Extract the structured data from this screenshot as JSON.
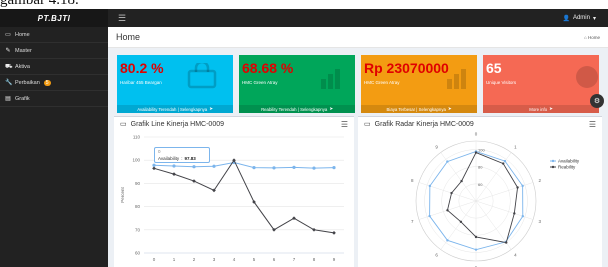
{
  "caption": "gambar 4.18.",
  "brand": "PT.BJTI",
  "admin": "Admin",
  "sidebar": [
    {
      "label": "Home",
      "icon": "monitor-icon"
    },
    {
      "label": "Master",
      "icon": "edit-icon"
    },
    {
      "label": "Aktiva",
      "icon": "truck-icon"
    },
    {
      "label": "Perbaikan",
      "icon": "wrench-icon",
      "badge": "5"
    },
    {
      "label": "Grafik",
      "icon": "bar-chart-icon"
    }
  ],
  "page_title": "Home",
  "breadcrumb": "Home",
  "tiles": [
    {
      "big": "80.2 %",
      "sub": "Haribar 455 Beargan",
      "foot": "Availability Terendah | Selengkapnya",
      "color": "#00c0ef",
      "big_color": "#e00000"
    },
    {
      "big": "68.68 %",
      "sub": "HMC Green Atray",
      "foot": "Reability Terendah | Selengkapnya",
      "color": "#00a65a",
      "big_color": "#e00000"
    },
    {
      "big": "Rp 23070000",
      "sub": "HMC Green Atray",
      "foot": "Biaya Terbesar | Selengkapnya",
      "color": "#f39c12",
      "big_color": "#e00000"
    },
    {
      "big": "65",
      "sub": "Unique Visitors",
      "foot": "More info",
      "color": "#f56954",
      "big_color": "#ffffff"
    }
  ],
  "line_panel": {
    "title": "Grafik Line Kinerja HMC-0009"
  },
  "radar_panel": {
    "title": "Grafik Radar Kinerja HMC-0009"
  },
  "tooltip": {
    "x": "0",
    "series": "Availability",
    "value": "97.83"
  },
  "chart_data": [
    {
      "type": "line",
      "title": "",
      "x": [
        0,
        1,
        2,
        3,
        4,
        5,
        6,
        7,
        8,
        9
      ],
      "ylabel": "Percent",
      "ylim": [
        60,
        110
      ],
      "yticks": [
        60,
        70,
        80,
        90,
        100,
        110
      ],
      "grid": true,
      "series": [
        {
          "name": "Availability",
          "color": "#7cb5ec",
          "values": [
            97.83,
            97.5,
            97.2,
            97.4,
            99.0,
            96.8,
            96.7,
            96.9,
            96.6,
            96.8
          ]
        },
        {
          "name": "Reability",
          "color": "#434348",
          "values": [
            96.5,
            94,
            91,
            87,
            100,
            82,
            70,
            75,
            70,
            68.68
          ]
        }
      ]
    },
    {
      "type": "radar",
      "title": "",
      "categories": [
        "0",
        "1",
        "2",
        "3",
        "4",
        "5",
        "6",
        "7",
        "8",
        "9"
      ],
      "radial_ticks": [
        60,
        80,
        100
      ],
      "rlim": [
        40,
        110
      ],
      "legend": "right",
      "series": [
        {
          "name": "Availability",
          "color": "#7cb5ec",
          "values": [
            97.83,
            97.5,
            97.2,
            97.4,
            99.0,
            96.8,
            96.7,
            96.9,
            96.6,
            96.8
          ]
        },
        {
          "name": "Reability",
          "color": "#434348",
          "values": [
            96.5,
            94,
            91,
            87,
            100,
            82,
            70,
            75,
            70,
            68.68
          ]
        }
      ]
    }
  ]
}
